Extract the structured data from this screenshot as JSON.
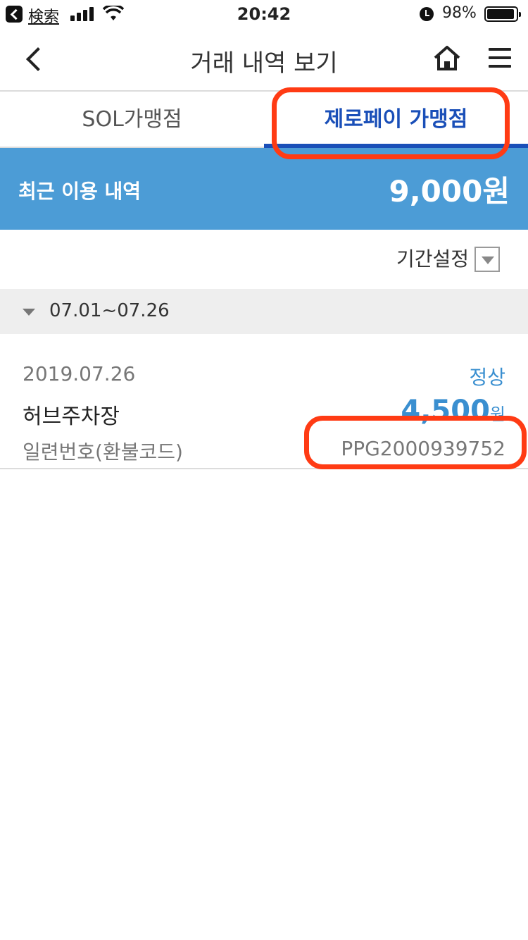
{
  "status_bar": {
    "back_label": "検索",
    "time": "20:42",
    "battery": "98%"
  },
  "nav": {
    "title": "거래 내역 보기"
  },
  "tabs": [
    {
      "label": "SOL가맹점"
    },
    {
      "label": "제로페이 가맹점"
    }
  ],
  "summary": {
    "label": "최근 이용 내역",
    "amount": "9,000원"
  },
  "period": {
    "label": "기간설정",
    "range": "07.01~07.26"
  },
  "transactions": [
    {
      "date": "2019.07.26",
      "status": "정상",
      "merchant": "허브주차장",
      "amount": "4,500",
      "amount_unit": "원",
      "serial_label": "일련번호(환불코드)",
      "serial_value": "PPG2000939752"
    }
  ],
  "colors": {
    "accent": "#1a4fb8",
    "summary_bg": "#4c9cd6",
    "highlight": "#ff3b14"
  }
}
